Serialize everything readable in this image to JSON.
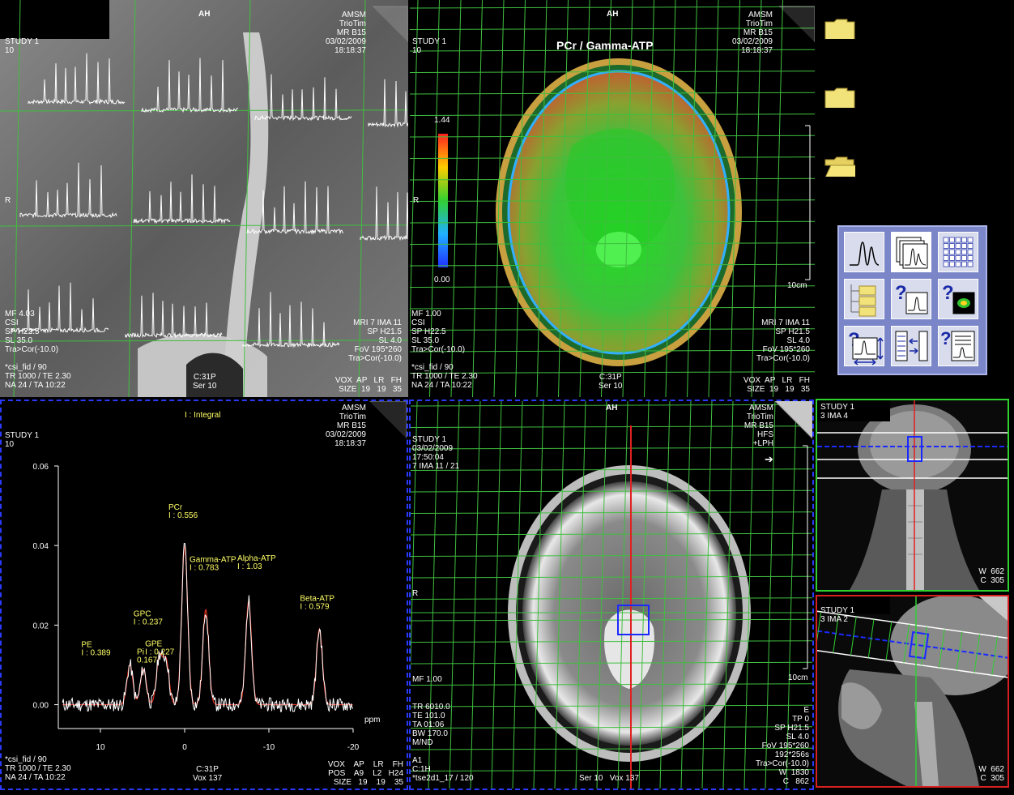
{
  "ul": {
    "tag_top": "AH",
    "tl": "STUDY 1\n10",
    "tr": "AMSM\nTrioTim\nMR B15\n03/02/2009\n18:18:37",
    "orient_r": "R",
    "bl": "MF 4.03\nCSI\nSP H22.5\nSL 35.0\nTra>Cor(-10.0)",
    "br": "MRI 7 IMA 11\nSP H21.5\nSL 4.0\nFoV 195*260\nTra>Cor(-10.0)",
    "bottom_left": "*csi_fid / 90\nTR 1000 / TE 2.30\nNA 24 / TA 10:22",
    "bottom_mid": "C:31P\nSer 10",
    "vox": "VOX  AP   LR   FH\nSIZE  19   19   35"
  },
  "ur": {
    "tag_top": "AH",
    "title": "PCr / Gamma-ATP",
    "tl": "STUDY 1\n10",
    "tr": "AMSM\nTrioTim\nMR B15\n03/02/2009\n18:18:37",
    "scale_max": "1.44",
    "scale_min": "0.00",
    "orient_r": "R",
    "scale_cm": "10cm",
    "bl": "MF 1.00\nCSI\nSP H22.5\nSL 35.0\nTra>Cor(-10.0)",
    "br": "MRI 7 IMA 11\nSP H21.5\nSL 4.0\nFoV 195*260\nTra>Cor(-10.0)",
    "bottom_left": "*csi_fid / 90\nTR 1000 / TE 2.30\nNA 24 / TA 10:22",
    "bottom_mid": "C:31P\nSer 10",
    "vox": "VOX  AP   LR   FH\nSIZE  19   19   35"
  },
  "ll": {
    "title": "I : Integral",
    "tl": "STUDY 1\n10",
    "tr": "AMSM\nTrioTim\nMR B15\n03/02/2009\n18:18:37",
    "bottom_left": "*csi_fid / 90\nTR 1000 / TE 2.30\nNA 24 / TA 10:22",
    "bottom_mid": "C:31P\nVox 137",
    "vox": "VOX    AP    LR    FH\nPOS    A9    L2   H24\nSIZE   19    19    35"
  },
  "lm": {
    "tag_top": "AH",
    "tl": "STUDY 1\n03/02/2009\n17:50:04\n7 IMA 11 / 21",
    "tr": "AMSM\nTrioTim\nMR B15\nHFS\n+LPH",
    "orient_r": "R",
    "scale_cm": "10cm",
    "mf": "MF 1.00",
    "bl": "TR 6010.0\nTE 101.0\nTA 01:06\nBW 170.0\nM/ND",
    "bl2": "A1\nC:1H\n*tse2d1_17 / 120",
    "bottom_mid": "Ser 10   Vox 137",
    "br": "E\nTP 0\nSP H21.5\nSL 4.0\nFoV 195*260\n192*256s\nTra>Cor(-10.0)\nW  1830\nC   862"
  },
  "rt": {
    "tl": "STUDY 1\n3 IMA 4",
    "wc": "W  662\nC  305"
  },
  "rb": {
    "tl": "STUDY 1\n3 IMA 2",
    "wc": "W  662\nC  305"
  },
  "tool_icons": [
    "spectrum-icon",
    "stacked-spectra-icon",
    "grid-icon",
    "folder-tree-icon",
    "query-spectrum-icon",
    "query-map-icon",
    "query-scale-icon",
    "list-arrows-icon",
    "spectrum-table-icon"
  ],
  "chart_data": {
    "type": "line",
    "title": "I : Integral",
    "xlabel": "ppm",
    "ylabel": "",
    "xlim": [
      15,
      -20
    ],
    "ylim": [
      -0.006,
      0.06
    ],
    "x_ticks": [
      "10",
      "0",
      "-10",
      "-20"
    ],
    "y_ticks": [
      "0.06",
      "0.04",
      "0.02",
      "0.00"
    ],
    "peaks": [
      {
        "name": "PE",
        "label": "I : 0.389",
        "ppm": 6.5,
        "height": 0.01
      },
      {
        "name": "Pi",
        "label": "0.167",
        "ppm": 4.9,
        "height": 0.009
      },
      {
        "name": "GPC",
        "label": "I : 0.237",
        "ppm": 3.0,
        "height": 0.012
      },
      {
        "name": "GPE",
        "label": "I : 0.227",
        "ppm": 2.2,
        "height": 0.011
      },
      {
        "name": "PCr",
        "label": "I : 0.556",
        "ppm": 0.0,
        "height": 0.04
      },
      {
        "name": "Gamma-ATP",
        "label": "I : 0.783",
        "ppm": -2.5,
        "height": 0.024
      },
      {
        "name": "Alpha-ATP",
        "label": "I : 1.03",
        "ppm": -7.6,
        "height": 0.026
      },
      {
        "name": "Beta-ATP",
        "label": "I : 0.579",
        "ppm": -16.0,
        "height": 0.019
      }
    ],
    "series": [
      {
        "color": "#ffffff"
      },
      {
        "color": "#e03020"
      }
    ]
  }
}
